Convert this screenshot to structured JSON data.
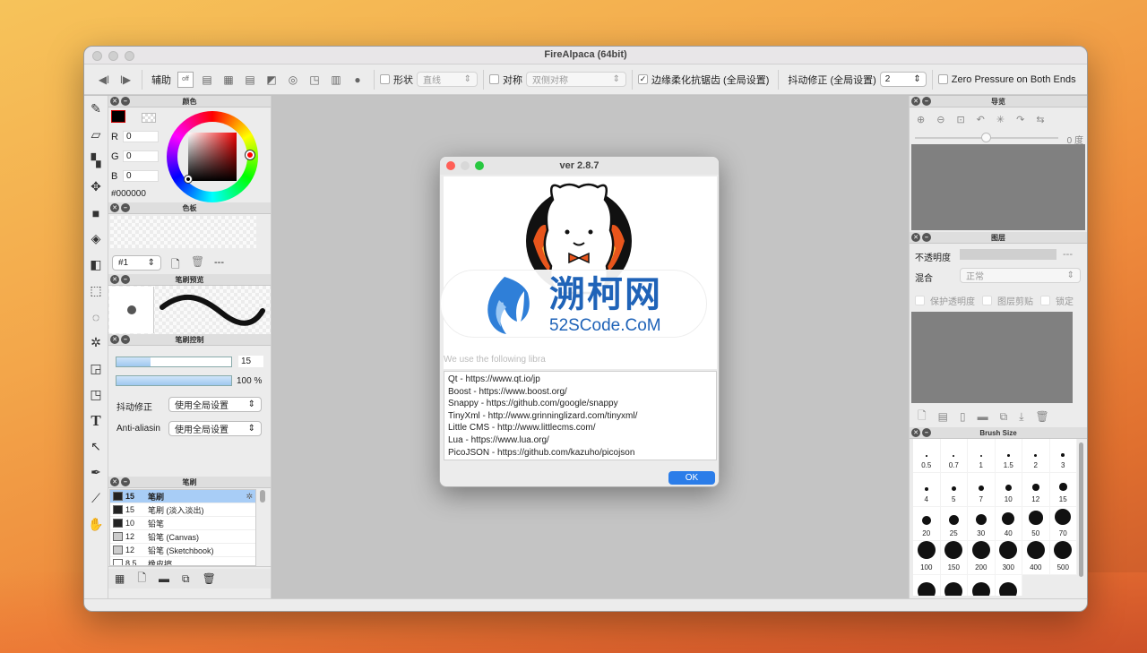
{
  "app": {
    "title": "FireAlpaca (64bit)"
  },
  "toolbar": {
    "assist_label": "辅助",
    "off_label": "off",
    "shape_label": "形状",
    "shape_select": "直线",
    "symmetry_label": "对称",
    "symmetry_select": "双侧对称",
    "antialias_label": "边缘柔化抗锯齿 (全局设置)",
    "stabilizer_label": "抖动修正 (全局设置)",
    "stabilizer_value": "2",
    "zero_pressure_label": "Zero Pressure on Both Ends"
  },
  "color_panel": {
    "title": "颜色",
    "r_label": "R",
    "r_value": "0",
    "g_label": "G",
    "g_value": "0",
    "b_label": "B",
    "b_value": "0",
    "hex": "#000000"
  },
  "palette_panel": {
    "title": "色板",
    "palette_select": "#1",
    "dash": "---"
  },
  "brush_preview_panel": {
    "title": "笔刷预览"
  },
  "brush_control_panel": {
    "title": "笔刷控制",
    "size_value": "15",
    "opacity_value": "100 %",
    "stabilizer_label": "抖动修正",
    "stabilizer_select": "使用全局设置",
    "antialias_label": "Anti-aliasin",
    "antialias_select": "使用全局设置"
  },
  "brush_panel": {
    "title": "笔刷",
    "items": [
      {
        "size": "15",
        "name": "笔刷"
      },
      {
        "size": "15",
        "name": "笔刷 (淡入淡出)"
      },
      {
        "size": "10",
        "name": "铅笔"
      },
      {
        "size": "12",
        "name": "铅笔 (Canvas)"
      },
      {
        "size": "12",
        "name": "铅笔 (Sketchbook)"
      },
      {
        "size": "8.5",
        "name": "橡皮擦"
      }
    ]
  },
  "navigator_panel": {
    "title": "导览",
    "angle": "0 度"
  },
  "layer_panel": {
    "title": "图层",
    "opacity_label": "不透明度",
    "opacity_value": "---",
    "blend_label": "混合",
    "blend_value": "正常",
    "protect_alpha": "保护透明度",
    "clipping": "图层剪贴",
    "lock": "锁定"
  },
  "brush_size_panel": {
    "title": "Brush Size",
    "sizes": [
      "0.5",
      "0.7",
      "1",
      "1.5",
      "2",
      "3",
      "4",
      "5",
      "7",
      "10",
      "12",
      "15",
      "20",
      "25",
      "30",
      "40",
      "50",
      "70",
      "100",
      "150",
      "200",
      "300",
      "400",
      "500"
    ]
  },
  "about_dialog": {
    "title": "ver 2.8.7",
    "intro_text": "We use the following libra",
    "watermark_cn": "溯柯网",
    "watermark_en": "52SCode.CoM",
    "libraries": [
      "Qt - https://www.qt.io/jp",
      "Boost - https://www.boost.org/",
      "Snappy - https://github.com/google/snappy",
      "TinyXml - http://www.grinninglizard.com/tinyxml/",
      "Little CMS - http://www.littlecms.com/",
      "Lua - https://www.lua.org/",
      "PicoJSON - https://github.com/kazuho/picojson"
    ],
    "ok_label": "OK"
  },
  "colors": {
    "accent": "#2b7de9",
    "flame": "#e8551c",
    "selected_row": "#a8cdf6"
  }
}
